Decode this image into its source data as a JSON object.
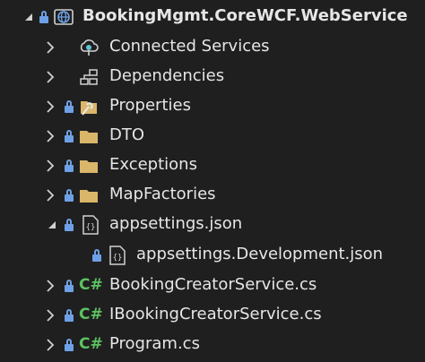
{
  "tree": {
    "root": {
      "label": "BookingMgmt.CoreWCF.WebService",
      "icon": "globe-project-icon",
      "expanded": true
    },
    "items": [
      {
        "label": "Connected Services",
        "icon": "connected-services-icon",
        "expanded": false
      },
      {
        "label": "Dependencies",
        "icon": "dependencies-icon",
        "expanded": false
      },
      {
        "label": "Properties",
        "icon": "properties-folder-icon",
        "expanded": false
      },
      {
        "label": "DTO",
        "icon": "folder-icon",
        "expanded": false
      },
      {
        "label": "Exceptions",
        "icon": "folder-icon",
        "expanded": false
      },
      {
        "label": "MapFactories",
        "icon": "folder-icon",
        "expanded": false
      },
      {
        "label": "appsettings.json",
        "icon": "json-file-icon",
        "expanded": true
      },
      {
        "label": "appsettings.Development.json",
        "icon": "json-file-icon"
      },
      {
        "label": "BookingCreatorService.cs",
        "icon": "csharp-file-icon",
        "icon_text": "C#",
        "expanded": false
      },
      {
        "label": "IBookingCreatorService.cs",
        "icon": "csharp-file-icon",
        "icon_text": "C#",
        "expanded": false
      },
      {
        "label": "Program.cs",
        "icon": "csharp-file-icon",
        "icon_text": "C#",
        "expanded": false
      }
    ]
  },
  "colors": {
    "background": "#1f1f1f",
    "text": "#e6e6e6",
    "lock": "#6ea0e6",
    "folder": "#d9b66a",
    "csharp": "#5cc261",
    "chevron": "#d0d0d0"
  }
}
